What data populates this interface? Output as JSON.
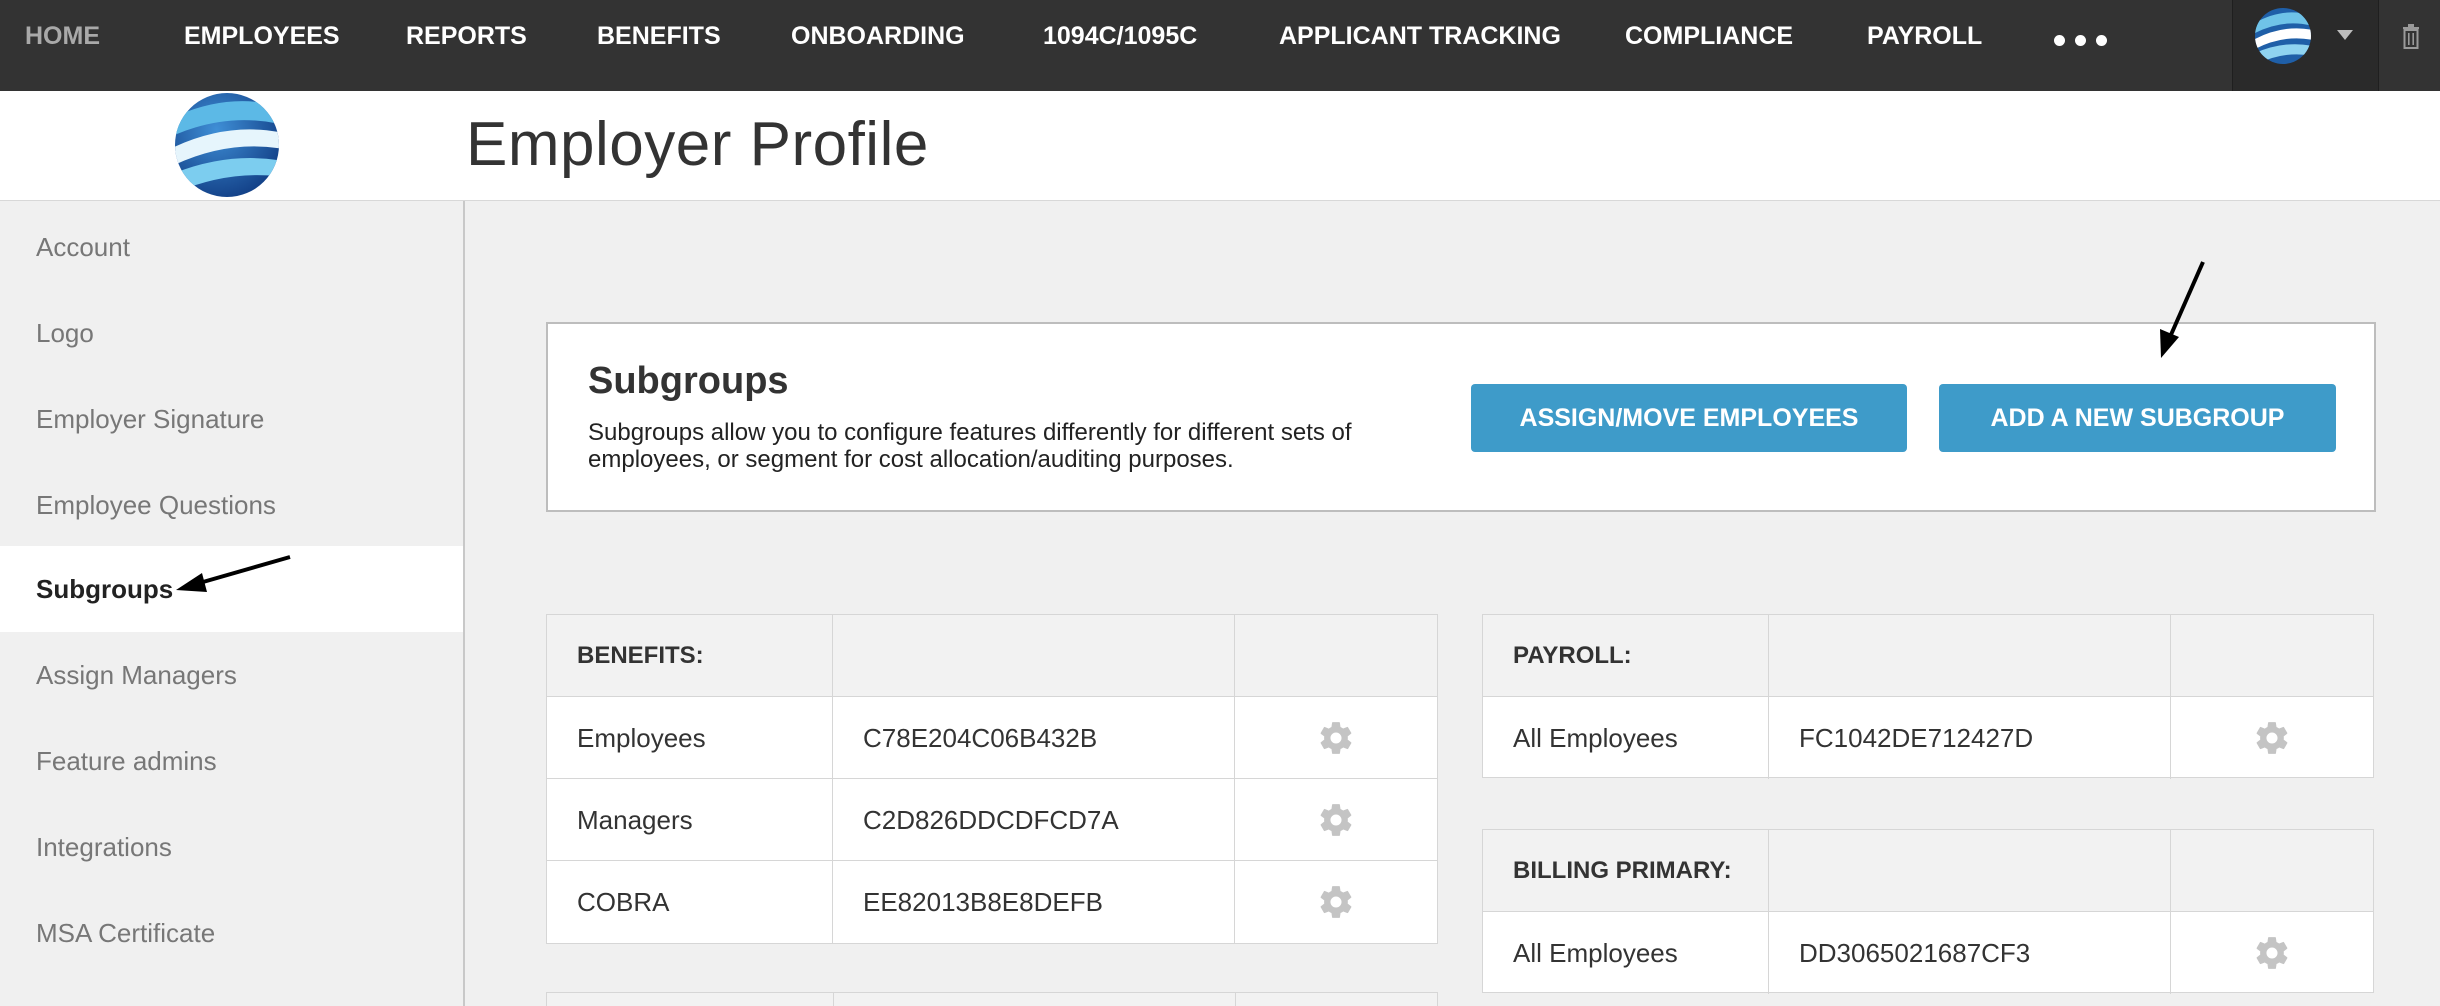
{
  "nav": {
    "items": [
      "HOME",
      "EMPLOYEES",
      "REPORTS",
      "BENEFITS",
      "ONBOARDING",
      "1094C/1095C",
      "APPLICANT TRACKING",
      "COMPLIANCE",
      "PAYROLL"
    ],
    "more_icon": "ellipsis-icon",
    "user_icon": "globe-logo-icon",
    "caret_icon": "caret-down-icon",
    "trash_icon": "trash-icon"
  },
  "header": {
    "title": "Employer Profile",
    "logo_icon": "globe-logo-icon"
  },
  "sidebar": {
    "items": [
      {
        "label": "Account"
      },
      {
        "label": "Logo"
      },
      {
        "label": "Employer Signature"
      },
      {
        "label": "Employee Questions"
      },
      {
        "label": "Subgroups",
        "active": true
      },
      {
        "label": "Assign Managers"
      },
      {
        "label": "Feature admins"
      },
      {
        "label": "Integrations"
      },
      {
        "label": "MSA Certificate"
      }
    ]
  },
  "subgroups": {
    "title": "Subgroups",
    "description": "Subgroups allow you to configure features differently for different sets of employees, or segment for cost allocation/auditing purposes.",
    "assign_button": "ASSIGN/MOVE EMPLOYEES",
    "add_button": "ADD A NEW SUBGROUP"
  },
  "tables": {
    "benefits": {
      "header": "BENEFITS:",
      "rows": [
        {
          "name": "Employees",
          "id": "C78E204C06B432B"
        },
        {
          "name": "Managers",
          "id": "C2D826DDCDFCD7A"
        },
        {
          "name": "COBRA",
          "id": "EE82013B8E8DEFB"
        }
      ]
    },
    "payroll": {
      "header": "PAYROLL:",
      "rows": [
        {
          "name": "All Employees",
          "id": "FC1042DE712427D"
        }
      ]
    },
    "billing": {
      "header": "BILLING PRIMARY:",
      "rows": [
        {
          "name": "All Employees",
          "id": "DD3065021687CF3"
        }
      ]
    }
  },
  "colors": {
    "nav_bg": "#333333",
    "button_blue": "#3e9bc9",
    "page_bg": "#f0f0f0"
  }
}
